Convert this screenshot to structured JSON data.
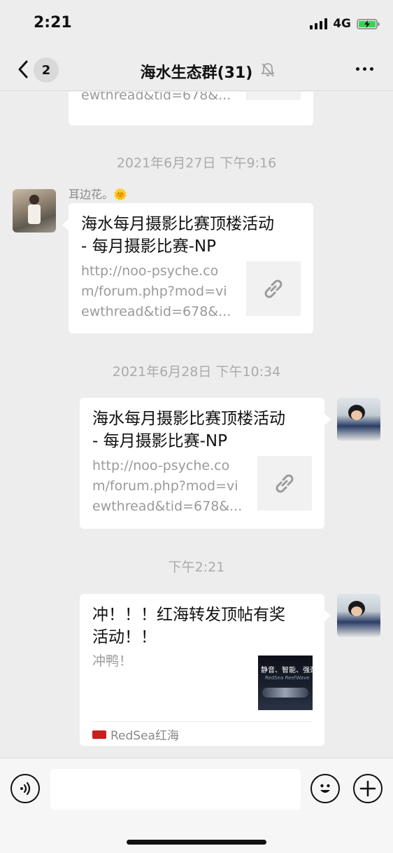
{
  "status_bar": {
    "time": "2:21",
    "network": "4G",
    "battery_percent": 100
  },
  "nav": {
    "unread_count": "2",
    "title": "海水生态群(31)"
  },
  "messages": {
    "top_partial": {
      "desc_last_line": "ewthread&tid=678&..."
    },
    "ts1": "2021年6月27日 下午9:16",
    "msg1": {
      "sender": "耳边花。🌞",
      "title_line1": "海水每月摄影比赛顶楼活动",
      "title_line2": " - 每月摄影比赛-NP",
      "desc_line1": "http://noo-psyche.co",
      "desc_line2": "m/forum.php?mod=vi",
      "desc_line3": "ewthread&tid=678&..."
    },
    "ts2": "2021年6月28日 下午10:34",
    "msg2": {
      "title_line1": "海水每月摄影比赛顶楼活动",
      "title_line2": " - 每月摄影比赛-NP",
      "desc_line1": "http://noo-psyche.co",
      "desc_line2": "m/forum.php?mod=vi",
      "desc_line3": "ewthread&tid=678&..."
    },
    "ts3": "下午2:21",
    "msg3": {
      "title_line1": "冲！！！红海转发顶帖有奖",
      "title_line2": "活动！！",
      "desc": "冲鸭！",
      "thumb_text": "静音、智能、强劲",
      "thumb_subtext": "RedSea ReefWave",
      "source": "RedSea红海"
    }
  },
  "input": {
    "placeholder": ""
  },
  "colors": {
    "background": "#ededed",
    "bubble": "#ffffff",
    "timestamp": "#aaaaaa",
    "battery": "#39d353",
    "brand_red": "#c81e1e"
  }
}
